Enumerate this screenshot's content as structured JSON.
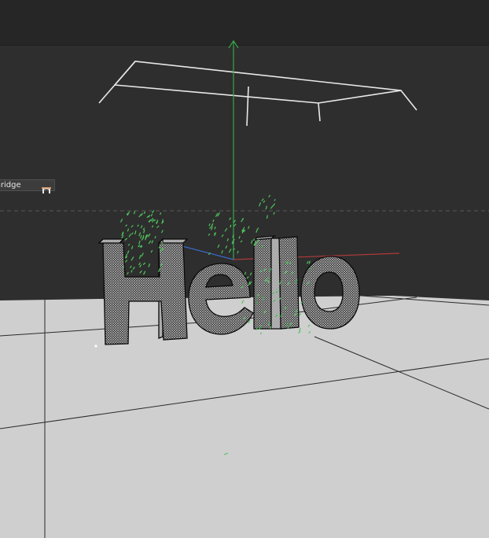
{
  "app": {
    "viewport_title": "",
    "background_color": "#2e2e2e",
    "floor_color": "#cfcfcf"
  },
  "scene": {
    "text_object": "Hello",
    "node_label": "Bridge",
    "node_icon": "bridge-icon",
    "axis_colors": {
      "x": "#b03a3a",
      "y": "#3aa54a",
      "z": "#3a6ac8"
    },
    "particle_color": "#4fc45c",
    "camera_outline_color": "#e8e8e8"
  }
}
